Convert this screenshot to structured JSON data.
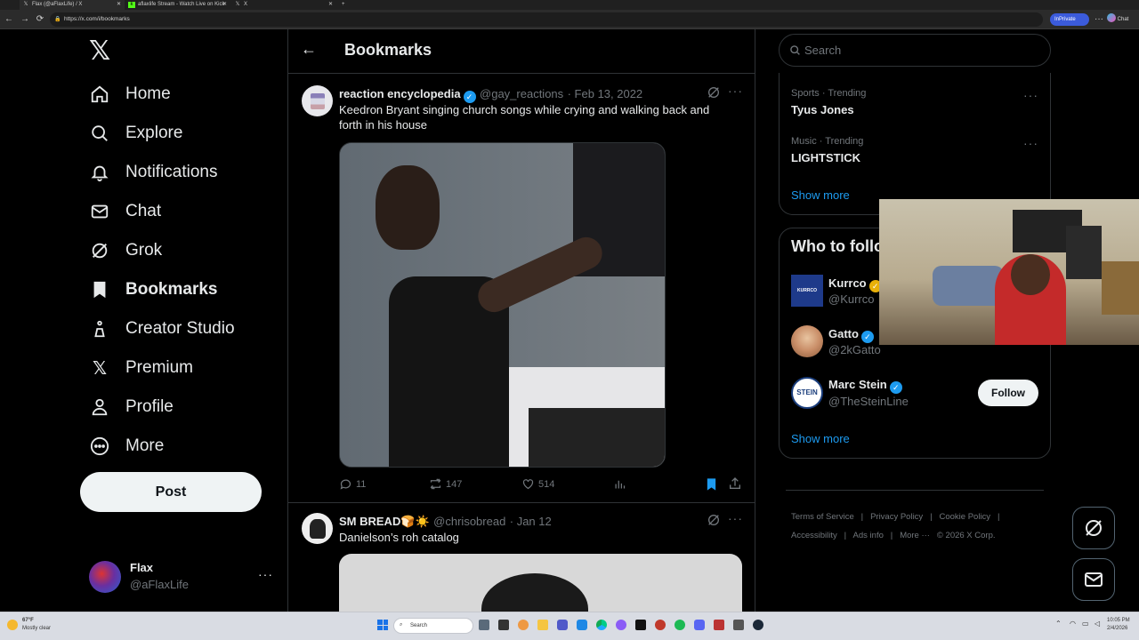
{
  "browser": {
    "tabs": [
      {
        "label": "Flax (@aFlaxLife) / X",
        "icon": "x-logo-icon"
      },
      {
        "label": "aflaxlife Stream - Watch Live on Kick",
        "icon": "kick-icon"
      },
      {
        "label": "X",
        "icon": "x-logo-icon"
      }
    ],
    "new_tab": "+",
    "url": "https://x.com/i/bookmarks",
    "inprivate": "InPrivate",
    "chat": "Chat"
  },
  "nav": {
    "items": [
      {
        "label": "Home",
        "icon": "home-icon"
      },
      {
        "label": "Explore",
        "icon": "search-icon"
      },
      {
        "label": "Notifications",
        "icon": "bell-icon"
      },
      {
        "label": "Chat",
        "icon": "mail-icon"
      },
      {
        "label": "Grok",
        "icon": "grok-icon"
      },
      {
        "label": "Bookmarks",
        "icon": "bookmark-icon"
      },
      {
        "label": "Creator Studio",
        "icon": "creator-studio-icon"
      },
      {
        "label": "Premium",
        "icon": "x-logo-icon"
      },
      {
        "label": "Profile",
        "icon": "person-icon"
      },
      {
        "label": "More",
        "icon": "more-circle-icon"
      }
    ],
    "post_button": "Post",
    "account": {
      "name": "Flax",
      "handle": "@aFlaxLife",
      "more": "···"
    }
  },
  "header": {
    "title": "Bookmarks"
  },
  "posts": [
    {
      "name": "reaction encyclopedia",
      "handle": "@gay_reactions",
      "date": "· Feb 13, 2022",
      "text": "Keedron Bryant singing church songs while crying and walking back and forth in his house",
      "replies": "11",
      "reposts": "147",
      "likes": "514",
      "bookmarked": true
    },
    {
      "name": "SM BREAD🍞☀️",
      "handle": "@chrisobread",
      "date": "· Jan 12",
      "text": "Danielson’s roh catalog"
    }
  ],
  "right": {
    "search_placeholder": "Search",
    "trends": [
      {
        "meta": "Sports · Trending",
        "title": "Tyus Jones"
      },
      {
        "meta": "Music · Trending",
        "title": "LIGHTSTICK"
      }
    ],
    "trends_show_more": "Show more",
    "who_title": "Who to follow",
    "who": [
      {
        "name": "Kurrco",
        "handle": "@Kurrco",
        "badge": "gold"
      },
      {
        "name": "Gatto",
        "handle": "@2kGatto",
        "badge": "blue"
      },
      {
        "name": "Marc Stein",
        "handle": "@TheSteinLine",
        "badge": "blue",
        "follow": "Follow"
      }
    ],
    "who_show_more": "Show more",
    "footer": [
      "Terms of Service",
      "|",
      "Privacy Policy",
      "|",
      "Cookie Policy",
      "|",
      "Accessibility",
      "|",
      "Ads info",
      "|",
      "More ···",
      "© 2026 X Corp."
    ]
  },
  "taskbar": {
    "weather_temp": "67°F",
    "weather_desc": "Mostly clear",
    "search": "Search",
    "time": "10:05 PM",
    "date": "2/4/2026"
  },
  "colors": {
    "accent": "#1d9bf0",
    "bg": "#000000",
    "border": "#2f3336",
    "muted": "#71767b"
  }
}
